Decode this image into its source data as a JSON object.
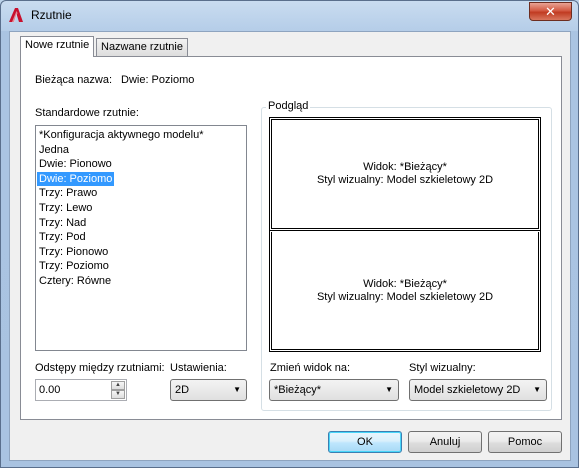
{
  "window": {
    "title": "Rzutnie",
    "close_label": "✕"
  },
  "tabs": [
    {
      "label": "Nowe rzutnie"
    },
    {
      "label": "Nazwane rzutnie"
    }
  ],
  "current_name": {
    "label": "Bieżąca nazwa:",
    "value": "Dwie: Poziomo"
  },
  "standard_viewports": {
    "label": "Standardowe rzutnie:",
    "items": [
      "*Konfiguracja aktywnego modelu*",
      "Jedna",
      "Dwie: Pionowo",
      "Dwie: Poziomo",
      "Trzy: Prawo",
      "Trzy: Lewo",
      "Trzy: Nad",
      "Trzy: Pod",
      "Trzy: Pionowo",
      "Trzy: Poziomo",
      "Cztery: Równe"
    ],
    "selected": "Dwie: Poziomo"
  },
  "preview": {
    "label": "Podgląd",
    "viewports": [
      {
        "view": "Widok: *Bieżący*",
        "visual_style": "Styl wizualny: Model szkieletowy 2D"
      },
      {
        "view": "Widok: *Bieżący*",
        "visual_style": "Styl wizualny: Model szkieletowy 2D"
      }
    ]
  },
  "spacing": {
    "label": "Odstępy między rzutniami:",
    "value": "0.00"
  },
  "setup": {
    "label": "Ustawienia:",
    "value": "2D"
  },
  "change_view": {
    "label": "Zmień widok na:",
    "value": "*Bieżący*"
  },
  "visual_style": {
    "label": "Styl wizualny:",
    "value": "Model szkieletowy 2D"
  },
  "buttons": {
    "ok": "OK",
    "cancel": "Anuluj",
    "help": "Pomoc"
  }
}
